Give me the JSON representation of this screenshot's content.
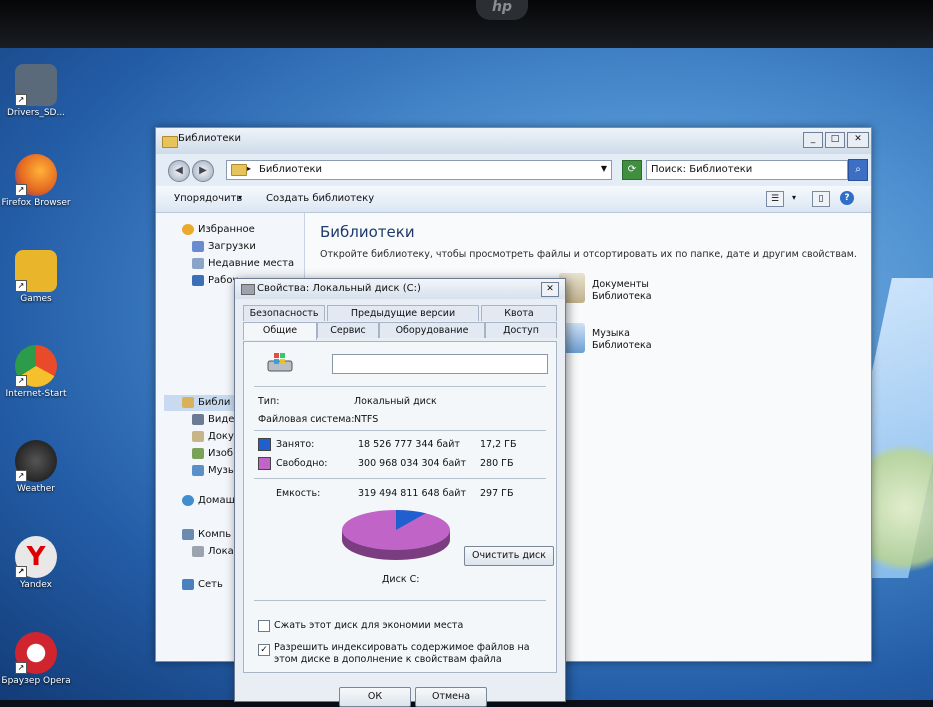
{
  "desktop": {
    "icons": [
      {
        "label": "Drivers_SD...",
        "color": "#5a6a7a"
      },
      {
        "label": "Firefox Browser",
        "color": "#e66a1f"
      },
      {
        "label": "Games",
        "color": "#e9b52a"
      },
      {
        "label": "Internet-Start",
        "color": "#e94a2a"
      },
      {
        "label": "Weather",
        "color": "#222222"
      },
      {
        "label": "Yandex",
        "color": "#e8e8e8"
      },
      {
        "label": "Браузер Opera",
        "color": "#d0242e"
      }
    ],
    "hp_logo": "hp"
  },
  "explorer": {
    "title": "Библиотеки",
    "address": "Библиотеки",
    "search_placeholder": "Поиск: Библиотеки",
    "toolbar": {
      "organize": "Упорядочить",
      "create_library": "Создать библиотеку"
    },
    "nav": {
      "favorites": "Избранное",
      "downloads": "Загрузки",
      "recent": "Недавние места",
      "desktop": "Рабоч",
      "libraries": "Библи",
      "videos": "Видео",
      "documents": "Докум",
      "images": "Изобр",
      "music": "Музы",
      "homegroup": "Домаш",
      "computer": "Компь",
      "local": "Локал",
      "network": "Сеть"
    },
    "heading": "Библиотеки",
    "subheading": "Откройте библиотеку, чтобы просмотреть файлы и отсортировать их по папке, дате и другим свойствам.",
    "libraries": [
      {
        "name": "Документы",
        "kind": "Библиотека"
      },
      {
        "name": "Музыка",
        "kind": "Библиотека"
      }
    ]
  },
  "dialog": {
    "title": "Свойства: Локальный диск (C:)",
    "tabs_row1": [
      "Безопасность",
      "Предыдущие версии",
      "Квота"
    ],
    "tabs_row2": [
      "Общие",
      "Сервис",
      "Оборудование",
      "Доступ"
    ],
    "type_label": "Тип:",
    "type_value": "Локальный диск",
    "fs_label": "Файловая система:",
    "fs_value": "NTFS",
    "used_label": "Занято:",
    "used_bytes": "18 526 777 344 байт",
    "used_gb": "17,2 ГБ",
    "free_label": "Свободно:",
    "free_bytes": "300 968 034 304 байт",
    "free_gb": "280 ГБ",
    "capacity_label": "Емкость:",
    "capacity_bytes": "319 494 811 648 байт",
    "capacity_gb": "297 ГБ",
    "used_fraction": 0.058,
    "used_color": "#1f5fcf",
    "free_color": "#c064c8",
    "cleanup_button": "Очистить диск",
    "disk_label": "Диск C:",
    "compress_label": "Сжать этот диск для экономии места",
    "compress_checked": false,
    "index_label_1": "Разрешить индексировать содержимое файлов на",
    "index_label_2": "этом диске в дополнение к свойствам файла",
    "index_checked": true,
    "ok_button": "ОК",
    "cancel_button": "Отмена"
  }
}
